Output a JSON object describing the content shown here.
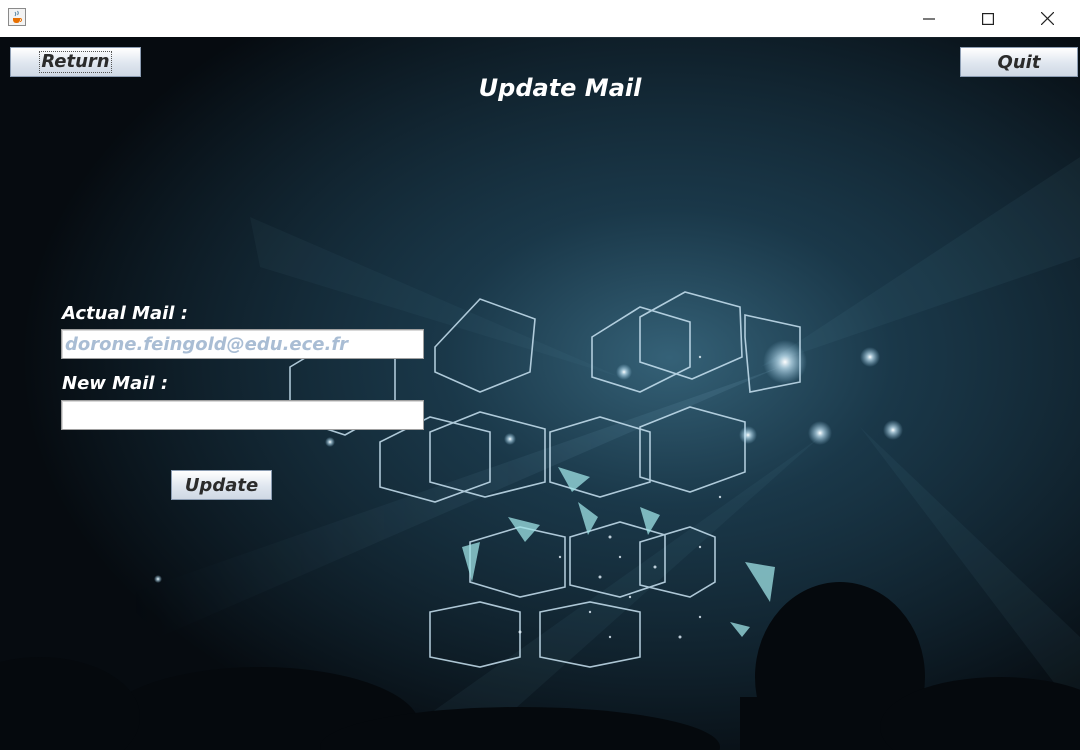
{
  "window": {
    "app_icon": "java-coffee-cup-icon",
    "controls": {
      "minimize_icon": "minimize-icon",
      "maximize_icon": "maximize-icon",
      "close_icon": "close-icon"
    }
  },
  "toolbar": {
    "return_label": "Return",
    "quit_label": "Quit"
  },
  "page": {
    "title": "Update Mail"
  },
  "form": {
    "actual_mail_label": "Actual Mail :",
    "actual_mail_value": "dorone.feingold@edu.ece.fr",
    "new_mail_label": "New Mail :",
    "new_mail_value": "",
    "update_label": "Update"
  },
  "colors": {
    "background": "#0d1a24",
    "text": "#ffffff",
    "readonly_text": "#a9bdd4",
    "button_border": "#8c9db3"
  }
}
